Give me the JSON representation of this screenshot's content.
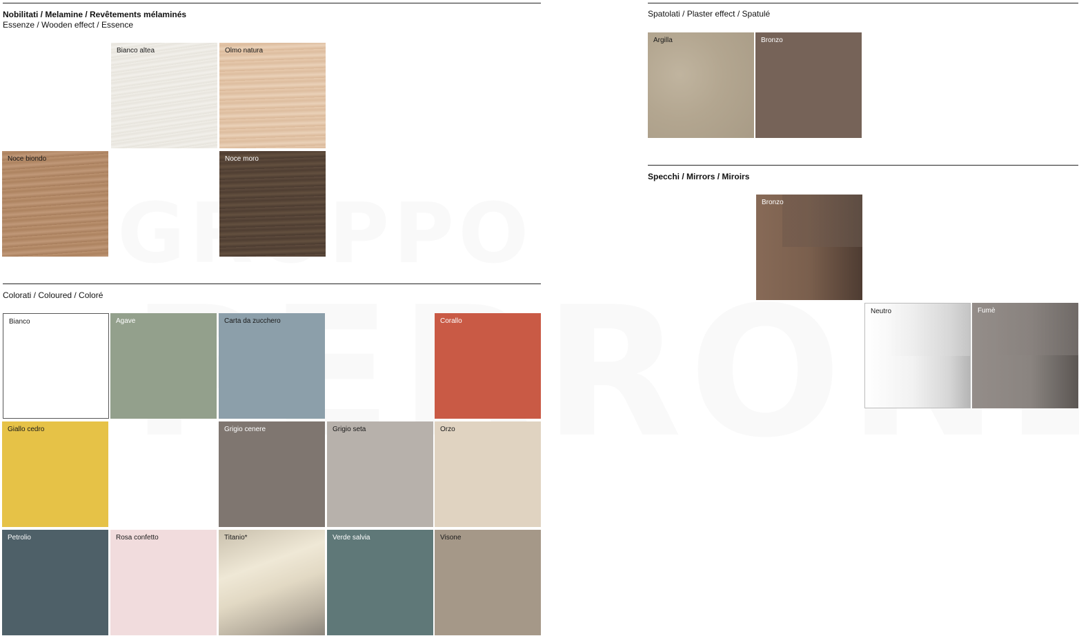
{
  "melamine": {
    "title": "Nobilitati / Melamine / Revêtements mélaminés",
    "subtitle": "Essenze / Wooden effect / Essence",
    "swatches": [
      {
        "label": "Bianco altea",
        "color": "#ece9e2"
      },
      {
        "label": "Olmo natura",
        "color": "#e3c5aa"
      },
      {
        "label": "Noce biondo",
        "color": "#b58a66"
      },
      {
        "label": "Noce moro",
        "color": "#584638"
      }
    ]
  },
  "coloured": {
    "title": "Colorati / Coloured / Coloré",
    "swatches": [
      {
        "label": "Bianco",
        "color": "#ffffff"
      },
      {
        "label": "Agave",
        "color": "#93a08c"
      },
      {
        "label": "Carta da zucchero",
        "color": "#8c9faa"
      },
      {
        "label": "Corallo",
        "color": "#c95a45"
      },
      {
        "label": "Giallo cedro",
        "color": "#e6c247"
      },
      {
        "label": "Grigio cenere",
        "color": "#7f7670"
      },
      {
        "label": "Grigio seta",
        "color": "#b7b1ab"
      },
      {
        "label": "Orzo",
        "color": "#e0d3c1"
      },
      {
        "label": "Petrolio",
        "color": "#4e6068"
      },
      {
        "label": "Rosa confetto",
        "color": "#f1dcdd"
      },
      {
        "label": "Titanio*",
        "color": "#ddd5c2"
      },
      {
        "label": "Verde salvia",
        "color": "#5f7878"
      },
      {
        "label": "Visone",
        "color": "#a59888"
      }
    ]
  },
  "plaster": {
    "title": "Spatolati / Plaster effect / Spatulé",
    "swatches": [
      {
        "label": "Argilla",
        "color": "#b3a690"
      },
      {
        "label": "Bronzo",
        "color": "#766358"
      }
    ]
  },
  "mirrors": {
    "title": "Specchi / Mirrors / Miroirs",
    "swatches": [
      {
        "label": "Bronzo",
        "color": "#7b6050"
      },
      {
        "label": "Neutro",
        "color": "#e6e6e6"
      },
      {
        "label": "Fumè",
        "color": "#8a8582"
      }
    ]
  },
  "watermark": {
    "line1": "GRUPPO",
    "line2": "PERRONE"
  }
}
